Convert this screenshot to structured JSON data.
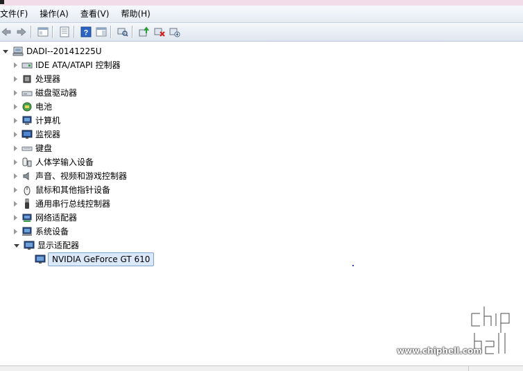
{
  "menubar": {
    "items": [
      "文件(F)",
      "操作(A)",
      "查看(V)",
      "帮助(H)"
    ]
  },
  "tree": {
    "root": "DADI--20141225U",
    "categories": [
      {
        "label": "IDE ATA/ATAPI 控制器",
        "icon": "ide-controller-icon"
      },
      {
        "label": "处理器",
        "icon": "processor-icon"
      },
      {
        "label": "磁盘驱动器",
        "icon": "disk-drive-icon"
      },
      {
        "label": "电池",
        "icon": "battery-icon"
      },
      {
        "label": "计算机",
        "icon": "computer-icon"
      },
      {
        "label": "监视器",
        "icon": "monitor-icon"
      },
      {
        "label": "键盘",
        "icon": "keyboard-icon"
      },
      {
        "label": "人体学输入设备",
        "icon": "hid-icon"
      },
      {
        "label": "声音、视频和游戏控制器",
        "icon": "sound-icon"
      },
      {
        "label": "鼠标和其他指针设备",
        "icon": "mouse-icon"
      },
      {
        "label": "通用串行总线控制器",
        "icon": "usb-icon"
      },
      {
        "label": "网络适配器",
        "icon": "network-adapter-icon"
      },
      {
        "label": "系统设备",
        "icon": "system-device-icon"
      },
      {
        "label": "显示适配器",
        "icon": "display-adapter-icon",
        "expanded": true
      }
    ],
    "child": "NVIDIA GeForce GT 610"
  },
  "watermark": {
    "logo": "chip hell",
    "url": "www.chiphell.com"
  }
}
